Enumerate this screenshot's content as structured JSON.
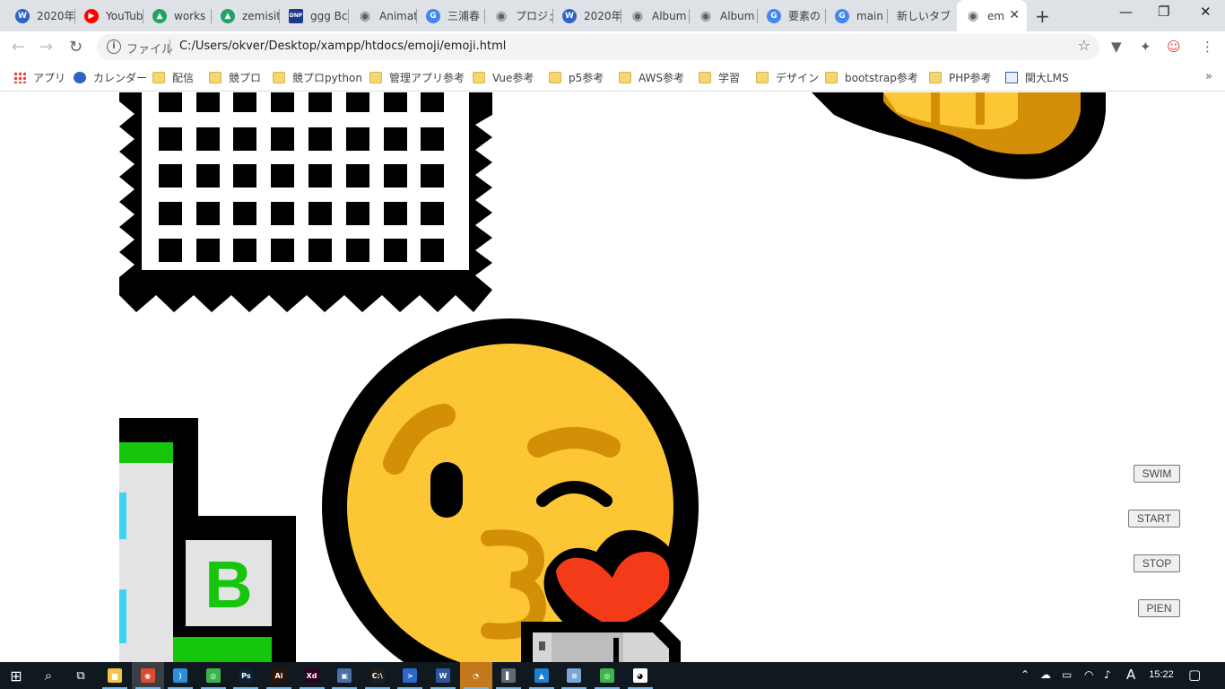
{
  "browser": {
    "tabs": [
      {
        "title": "2020年",
        "icon": "w-logo-icon",
        "color": "#2b63c6",
        "glyph": "W"
      },
      {
        "title": "YouTub",
        "icon": "youtube-icon",
        "color": "#ff0000",
        "glyph": "▶"
      },
      {
        "title": "works",
        "icon": "google-drive-icon",
        "color": "#1fa463",
        "glyph": "▲"
      },
      {
        "title": "zemisit",
        "icon": "google-drive-icon",
        "color": "#1fa463",
        "glyph": "▲"
      },
      {
        "title": "ggg Bc",
        "icon": "dnp-icon",
        "color": "#1b3a8a",
        "glyph": "DNP"
      },
      {
        "title": "Animat",
        "icon": "globe-icon",
        "color": "#5f6368",
        "glyph": "◉"
      },
      {
        "title": "三浦春",
        "icon": "google-icon",
        "color": "#4285f4",
        "glyph": "G"
      },
      {
        "title": "プロジェ",
        "icon": "globe-icon",
        "color": "#5f6368",
        "glyph": "◉"
      },
      {
        "title": "2020年",
        "icon": "w-logo-icon",
        "color": "#2b63c6",
        "glyph": "W"
      },
      {
        "title": "Album",
        "icon": "globe-icon",
        "color": "#5f6368",
        "glyph": "◉"
      },
      {
        "title": "Album",
        "icon": "globe-icon",
        "color": "#5f6368",
        "glyph": "◉"
      },
      {
        "title": "要素の",
        "icon": "google-icon",
        "color": "#4285f4",
        "glyph": "G"
      },
      {
        "title": "main r",
        "icon": "google-icon",
        "color": "#4285f4",
        "glyph": "G"
      },
      {
        "title": "新しいタブ",
        "icon": "",
        "color": "",
        "glyph": ""
      },
      {
        "title": "em",
        "icon": "globe-icon",
        "color": "#5f6368",
        "glyph": "◉",
        "active": true
      }
    ],
    "scheme_label": "ファイル",
    "url": "C:/Users/okver/Desktop/xampp/htdocs/emoji/emoji.html",
    "bookmarks": [
      {
        "label": "アプリ",
        "icon": "apps-grid-icon"
      },
      {
        "label": "カレンダー",
        "icon": "w-logo-icon"
      },
      {
        "label": "配信",
        "icon": "folder-icon"
      },
      {
        "label": "競プロ",
        "icon": "folder-icon"
      },
      {
        "label": "競プロpython",
        "icon": "folder-icon"
      },
      {
        "label": "管理アプリ参考",
        "icon": "folder-icon"
      },
      {
        "label": "Vue参考",
        "icon": "folder-icon"
      },
      {
        "label": "p5参考",
        "icon": "folder-icon"
      },
      {
        "label": "AWS参考",
        "icon": "folder-icon"
      },
      {
        "label": "学習",
        "icon": "folder-icon"
      },
      {
        "label": "デザイン",
        "icon": "folder-icon"
      },
      {
        "label": "bootstrap参考",
        "icon": "folder-icon"
      },
      {
        "label": "PHP参考",
        "icon": "folder-icon"
      },
      {
        "label": "関大LMS",
        "icon": "kansai-lms-icon"
      }
    ]
  },
  "page": {
    "buttons": {
      "swim": "SWIM",
      "start": "START",
      "stop": "STOP",
      "pien": "PIEN"
    },
    "sign_letter": "B",
    "colors": {
      "face": "#fdc634",
      "face_feature": "#d48f08",
      "heart": "#f43b19",
      "sign_green": "#16c60c",
      "sign_cyan": "#3ad3f5"
    }
  },
  "taskbar": {
    "clock": "15:22",
    "ime": "A",
    "apps": [
      {
        "name": "file-explorer",
        "glyph": "▆",
        "color": "#f4c542"
      },
      {
        "name": "chrome",
        "glyph": "◉",
        "color": "#e0492f",
        "active": true
      },
      {
        "name": "vscode",
        "glyph": "⟩",
        "color": "#2a8fd6"
      },
      {
        "name": "app-green",
        "glyph": "◎",
        "color": "#3bb54a"
      },
      {
        "name": "photoshop",
        "glyph": "Ps",
        "color": "#0b2236"
      },
      {
        "name": "illustrator",
        "glyph": "Ai",
        "color": "#2e1306"
      },
      {
        "name": "adobe-xd",
        "glyph": "Xd",
        "color": "#2e0021"
      },
      {
        "name": "app-tools",
        "glyph": "▣",
        "color": "#4a6fa5"
      },
      {
        "name": "cmd",
        "glyph": "C:\\",
        "color": "#1e1e1e"
      },
      {
        "name": "powershell",
        "glyph": ">",
        "color": "#2968c8"
      },
      {
        "name": "word",
        "glyph": "W",
        "color": "#2b579a"
      },
      {
        "name": "app-orange",
        "glyph": "◔",
        "color": "#c47a1c",
        "highlight": true
      },
      {
        "name": "app-audio",
        "glyph": "▌",
        "color": "#606a74"
      },
      {
        "name": "photos",
        "glyph": "▲",
        "color": "#1a7fd4"
      },
      {
        "name": "notepad",
        "glyph": "≡",
        "color": "#7aa7d9"
      },
      {
        "name": "app-green2",
        "glyph": "◎",
        "color": "#3bb54a"
      },
      {
        "name": "app-panda",
        "glyph": "◕",
        "color": "#ffffff"
      }
    ]
  }
}
